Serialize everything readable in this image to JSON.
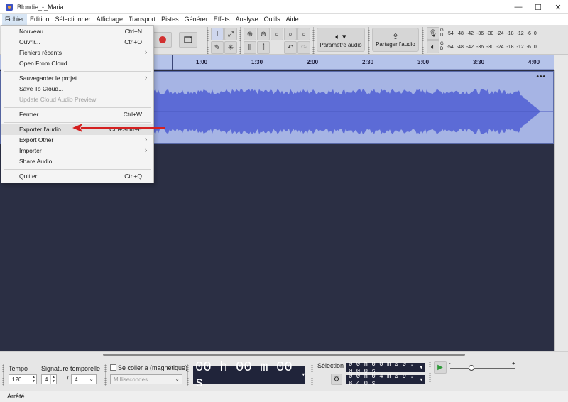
{
  "window": {
    "title": "Blondie_-_Maria",
    "controls": [
      "—",
      "☐",
      "✕"
    ]
  },
  "menubar": [
    "Fichier",
    "Édition",
    "Sélectionner",
    "Affichage",
    "Transport",
    "Pistes",
    "Générer",
    "Effets",
    "Analyse",
    "Outils",
    "Aide"
  ],
  "dropdown": {
    "items": [
      {
        "label": "Nouveau",
        "shortcut": "Ctrl+N",
        "submenu": false,
        "disabled": false
      },
      {
        "label": "Ouvrir...",
        "shortcut": "Ctrl+O",
        "submenu": false,
        "disabled": false
      },
      {
        "label": "Fichiers récents",
        "shortcut": "",
        "submenu": true,
        "disabled": false
      },
      {
        "label": "Open From Cloud...",
        "shortcut": "",
        "submenu": false,
        "disabled": false
      },
      {
        "label": "Sauvegarder le projet",
        "shortcut": "",
        "submenu": true,
        "disabled": false
      },
      {
        "label": "Save To Cloud...",
        "shortcut": "",
        "submenu": false,
        "disabled": false
      },
      {
        "label": "Update Cloud Audio Preview",
        "shortcut": "",
        "submenu": false,
        "disabled": true
      },
      {
        "label": "Fermer",
        "shortcut": "Ctrl+W",
        "submenu": false,
        "disabled": false
      },
      {
        "label": "Exporter l'audio...",
        "shortcut": "Ctrl+Shift+E",
        "submenu": false,
        "disabled": false
      },
      {
        "label": "Export Other",
        "shortcut": "",
        "submenu": true,
        "disabled": false
      },
      {
        "label": "Importer",
        "shortcut": "",
        "submenu": true,
        "disabled": false
      },
      {
        "label": "Share Audio...",
        "shortcut": "",
        "submenu": false,
        "disabled": false
      },
      {
        "label": "Quitter",
        "shortcut": "Ctrl+Q",
        "submenu": false,
        "disabled": false
      }
    ],
    "submenu_glyph": "›"
  },
  "toolbar": {
    "audio_setup_label": "Paramètre audio",
    "share_audio_label": "Partager l'audio",
    "meter_rec_channels": [
      "G",
      "D"
    ],
    "meter_play_channels": [
      "G",
      "D"
    ],
    "meter_ticks": [
      "-54",
      "-48",
      "-42",
      "-36",
      "-30",
      "-24",
      "-18",
      "-12",
      "-6",
      "0"
    ]
  },
  "ruler": {
    "labels": [
      "1:00",
      "1:30",
      "2:00",
      "2:30",
      "3:00",
      "3:30",
      "4:00"
    ]
  },
  "track": {
    "menu_glyph": "•••"
  },
  "bottom": {
    "tempo_label": "Tempo",
    "tempo_value": "120",
    "signature_label": "Signature temporelle",
    "signature_num": "4",
    "signature_sep": "/",
    "signature_den": "4",
    "snap_label": "Se coller à (magnétique)",
    "snap_unit": "Millisecondes",
    "time_display": "00 h 00 m 00 s",
    "selection_label": "Sélection",
    "selection_start": "0 0 h 0 0 m 0 0 . 0 0 0 s",
    "selection_end": "0 0 h 0 4 m 0 9 . 8 4 0 s",
    "play_speed_min": "-",
    "play_speed_max": "+"
  },
  "status": {
    "text": "Arrêté."
  },
  "colors": {
    "waveform": "#5c6bd6",
    "ruler": "#b5c3ea",
    "track_bg": "#a6b4e4",
    "annotation_arrow": "#d42020",
    "record_button": "#d23030",
    "play_button": "#2f9a3a"
  }
}
